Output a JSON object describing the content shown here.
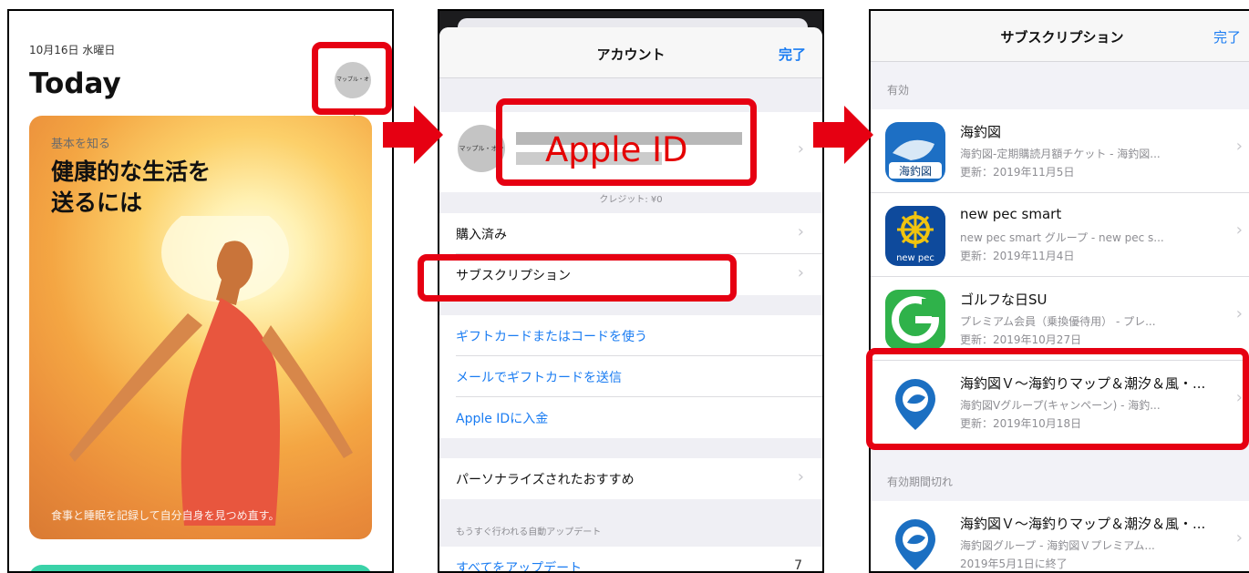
{
  "today": {
    "date": "10月16日 水曜日",
    "title": "Today",
    "avatar_text": "マップル・オン",
    "card": {
      "eyebrow": "基本を知る",
      "title": "健康的な生活を\n送るには",
      "caption": "食事と睡眠を記録して自分自身を見つめ直す。"
    }
  },
  "account": {
    "nav_title": "アカウント",
    "done": "完了",
    "avatar_text": "マップル・オン",
    "apple_id_label": "Apple ID",
    "credit": "クレジット: ¥0",
    "rows_group1": [
      {
        "label": "購入済み"
      },
      {
        "label": "サブスクリプション"
      }
    ],
    "rows_group2": [
      {
        "label": "ギフトカードまたはコードを使う"
      },
      {
        "label": "メールでギフトカードを送信"
      },
      {
        "label": "Apple IDに入金"
      }
    ],
    "rows_group3": [
      {
        "label": "パーソナライズされたおすすめ"
      }
    ],
    "auto_update_header": "もうすぐ行われる自動アップデート",
    "update_all": "すべてをアップデート",
    "update_count": "7"
  },
  "subscriptions": {
    "nav_title": "サブスクリプション",
    "done": "完了",
    "active_header": "有効",
    "expired_header": "有効期間切れ",
    "active": [
      {
        "name": "海釣図",
        "sub": "海釣図-定期購読月額チケット - 海釣図...",
        "date": "更新：2019年11月5日",
        "icon": "kaichozu-icon"
      },
      {
        "name": "new pec smart",
        "sub": "new pec smart グループ - new pec s...",
        "date": "更新：2019年11月4日",
        "icon": "new-pec-icon"
      },
      {
        "name": "ゴルフな日SU",
        "sub": "プレミアム会員（乗換優待用） - プレ...",
        "date": "更新：2019年10月27日",
        "icon": "golf-icon"
      },
      {
        "name": "海釣図Ｖ～海釣りマップ＆潮汐＆風・...",
        "sub": "海釣図Vグループ(キャンペーン) - 海釣...",
        "date": "更新：2019年10月18日",
        "icon": "kaichozu-v-icon"
      }
    ],
    "expired": [
      {
        "name": "海釣図Ｖ～海釣りマップ＆潮汐＆風・...",
        "sub": "海釣図グループ - 海釣図Ｖプレミアム...",
        "date": "2019年5月1日に終了",
        "icon": "kaichozu-v-icon"
      }
    ]
  },
  "colors": {
    "highlight": "#e60012",
    "ios_blue": "#1a7cf2"
  }
}
